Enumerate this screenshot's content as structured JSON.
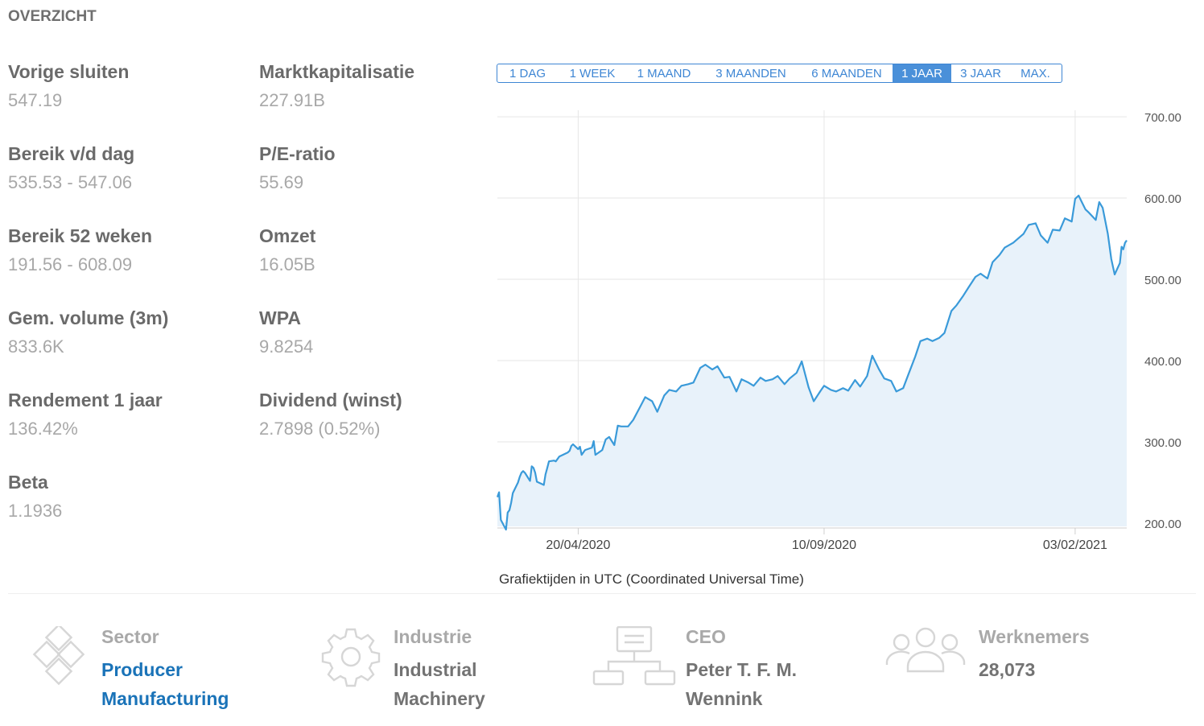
{
  "section_title": "OVERZICHT",
  "stats": [
    {
      "label": "Vorige sluiten",
      "value": "547.19"
    },
    {
      "label": "Marktkapitalisatie",
      "value": "227.91B"
    },
    {
      "label": "Bereik v/d dag",
      "value": "535.53 - 547.06"
    },
    {
      "label": "P/E-ratio",
      "value": "55.69"
    },
    {
      "label": "Bereik 52 weken",
      "value": "191.56 - 608.09"
    },
    {
      "label": "Omzet",
      "value": "16.05B"
    },
    {
      "label": "Gem. volume (3m)",
      "value": "833.6K"
    },
    {
      "label": "WPA",
      "value": "9.8254"
    },
    {
      "label": "Rendement 1 jaar",
      "value": "136.42%"
    },
    {
      "label": "Dividend (winst)",
      "value": "2.7898 (0.52%)"
    },
    {
      "label": "Beta",
      "value": "1.1936"
    }
  ],
  "range_buttons": [
    {
      "label": "1 DAG",
      "active": false
    },
    {
      "label": "1 WEEK",
      "active": false
    },
    {
      "label": "1 MAAND",
      "active": false
    },
    {
      "label": "3 MAANDEN",
      "active": false
    },
    {
      "label": "6 MAANDEN",
      "active": false
    },
    {
      "label": "1 JAAR",
      "active": true
    },
    {
      "label": "3 JAAR",
      "active": false
    },
    {
      "label": "MAX.",
      "active": false
    }
  ],
  "chart_note": "Grafiektijden in UTC (Coordinated Universal Time)",
  "chart_data": {
    "type": "area",
    "title": "",
    "xlabel": "",
    "ylabel": "",
    "x_tick_labels": [
      "20/04/2020",
      "10/09/2020",
      "03/02/2021"
    ],
    "y_tick_labels": [
      "700.00",
      "600.00",
      "500.00",
      "400.00",
      "300.00",
      "200.00"
    ],
    "y_ticks": [
      700,
      600,
      500,
      400,
      300,
      200
    ],
    "ylim": [
      196,
      708
    ],
    "x_range": [
      "2020-03-04",
      "2021-03-05"
    ],
    "x_tick_dates": [
      "2020-04-20",
      "2020-09-10",
      "2021-02-03"
    ],
    "grid": true,
    "line_color": "#3a9ad9",
    "fill_color": "#e8f2fa",
    "series": [
      {
        "x": [
          "2020-03-04",
          "2020-03-05",
          "2020-03-06",
          "2020-03-09",
          "2020-03-10",
          "2020-03-11",
          "2020-03-12",
          "2020-03-13",
          "2020-03-16",
          "2020-03-17",
          "2020-03-18",
          "2020-03-19",
          "2020-03-20",
          "2020-03-23",
          "2020-03-24",
          "2020-03-25",
          "2020-03-26",
          "2020-03-27",
          "2020-03-30",
          "2020-03-31",
          "2020-04-01",
          "2020-04-02",
          "2020-04-03",
          "2020-04-06",
          "2020-04-07",
          "2020-04-08",
          "2020-04-09",
          "2020-04-14",
          "2020-04-15",
          "2020-04-16",
          "2020-04-17",
          "2020-04-20",
          "2020-04-21",
          "2020-04-22",
          "2020-04-23",
          "2020-04-24",
          "2020-04-28",
          "2020-04-29",
          "2020-04-30",
          "2020-05-04",
          "2020-05-06",
          "2020-05-08",
          "2020-05-11",
          "2020-05-13",
          "2020-05-15",
          "2020-05-19",
          "2020-05-22",
          "2020-05-26",
          "2020-05-29",
          "2020-06-02",
          "2020-06-05",
          "2020-06-09",
          "2020-06-12",
          "2020-06-16",
          "2020-06-19",
          "2020-06-23",
          "2020-06-26",
          "2020-06-30",
          "2020-07-03",
          "2020-07-07",
          "2020-07-10",
          "2020-07-14",
          "2020-07-17",
          "2020-07-21",
          "2020-07-24",
          "2020-07-28",
          "2020-07-31",
          "2020-08-04",
          "2020-08-07",
          "2020-08-11",
          "2020-08-14",
          "2020-08-18",
          "2020-08-21",
          "2020-08-25",
          "2020-08-28",
          "2020-09-01",
          "2020-09-04",
          "2020-09-08",
          "2020-09-10",
          "2020-09-14",
          "2020-09-17",
          "2020-09-21",
          "2020-09-24",
          "2020-09-28",
          "2020-10-01",
          "2020-10-05",
          "2020-10-08",
          "2020-10-12",
          "2020-10-15",
          "2020-10-19",
          "2020-10-22",
          "2020-10-26",
          "2020-10-29",
          "2020-11-02",
          "2020-11-05",
          "2020-11-09",
          "2020-11-12",
          "2020-11-16",
          "2020-11-19",
          "2020-11-23",
          "2020-11-26",
          "2020-11-30",
          "2020-12-03",
          "2020-12-07",
          "2020-12-10",
          "2020-12-14",
          "2020-12-17",
          "2020-12-21",
          "2020-12-24",
          "2020-12-29",
          "2021-01-04",
          "2021-01-07",
          "2021-01-11",
          "2021-01-14",
          "2021-01-18",
          "2021-01-21",
          "2021-01-25",
          "2021-01-28",
          "2021-02-01",
          "2021-02-03",
          "2021-02-05",
          "2021-02-09",
          "2021-02-11",
          "2021-02-15",
          "2021-02-17",
          "2021-02-19",
          "2021-02-22",
          "2021-02-24",
          "2021-02-26",
          "2021-03-01",
          "2021-03-02",
          "2021-03-03",
          "2021-03-04",
          "2021-03-05"
        ],
        "values": [
          232,
          238,
          204,
          192,
          213,
          216,
          225,
          237,
          250,
          257,
          262,
          264,
          262,
          252,
          270,
          268,
          262,
          251,
          248,
          247,
          260,
          268,
          276,
          277,
          276,
          279,
          282,
          287,
          289,
          295,
          297,
          291,
          294,
          284,
          287,
          290,
          293,
          301,
          284,
          290,
          303,
          306,
          296,
          320,
          319,
          319,
          327,
          343,
          355,
          350,
          337,
          357,
          364,
          362,
          369,
          371,
          373,
          391,
          395,
          389,
          393,
          379,
          380,
          362,
          377,
          373,
          369,
          379,
          375,
          377,
          381,
          371,
          378,
          385,
          399,
          367,
          350,
          363,
          369,
          364,
          362,
          366,
          363,
          376,
          368,
          381,
          406,
          389,
          378,
          375,
          362,
          366,
          383,
          405,
          424,
          427,
          424,
          428,
          434,
          461,
          468,
          480,
          490,
          503,
          507,
          501,
          521,
          530,
          539,
          545,
          556,
          567,
          569,
          554,
          545,
          561,
          560,
          575,
          571,
          599,
          603,
          586,
          582,
          573,
          595,
          588,
          556,
          525,
          506,
          520,
          540,
          537,
          545,
          548
        ],
        "values_note": "",
        "name": ""
      }
    ]
  },
  "info_items": [
    {
      "icon": "sector-diamonds-icon",
      "label": "Sector",
      "value": "Producer Manufacturing",
      "link": true
    },
    {
      "icon": "industry-gear-icon",
      "label": "Industrie",
      "value": "Industrial Machinery",
      "link": false
    },
    {
      "icon": "ceo-org-chart-icon",
      "label": "CEO",
      "value": "Peter T. F. M. Wennink",
      "link": false
    },
    {
      "icon": "employees-group-icon",
      "label": "Werknemers",
      "value": "28,073",
      "link": false
    }
  ]
}
